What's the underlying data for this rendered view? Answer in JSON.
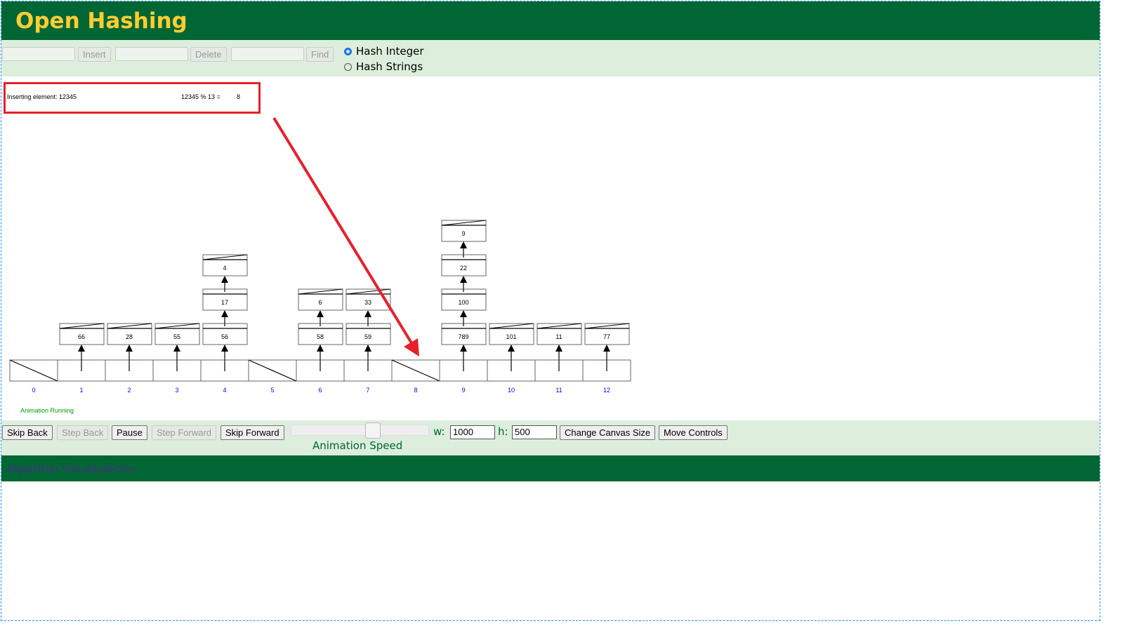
{
  "header": {
    "title": "Open Hashing"
  },
  "controls": {
    "insert_label": "Insert",
    "delete_label": "Delete",
    "find_label": "Find",
    "insert_value": "",
    "delete_value": "",
    "find_value": "",
    "radio_integer": "Hash Integer",
    "radio_strings": "Hash Strings",
    "selected": "Hash Integer"
  },
  "message": {
    "text": "Inserting element: 12345",
    "formula": "12345 % 13 =",
    "result": "8"
  },
  "hash_table": {
    "buckets": [
      "0",
      "1",
      "2",
      "3",
      "4",
      "5",
      "6",
      "7",
      "8",
      "9",
      "10",
      "11",
      "12"
    ],
    "chains": {
      "1": [
        "66"
      ],
      "2": [
        "28"
      ],
      "3": [
        "55"
      ],
      "4": [
        "56",
        "17",
        "4"
      ],
      "6": [
        "58",
        "6"
      ],
      "7": [
        "59",
        "33"
      ],
      "9": [
        "789",
        "100",
        "22",
        "9"
      ],
      "10": [
        "101"
      ],
      "11": [
        "11"
      ],
      "12": [
        "77"
      ]
    }
  },
  "status": "Animation Running",
  "animation": {
    "skip_back": "Skip Back",
    "step_back": "Step Back",
    "pause": "Pause",
    "step_forward": "Step Forward",
    "skip_forward": "Skip Forward",
    "speed_label": "Animation Speed",
    "speed_fraction": 0.6,
    "w_label": "w:",
    "w_value": "1000",
    "h_label": "h:",
    "h_value": "500",
    "change_canvas": "Change Canvas Size",
    "move_controls": "Move Controls"
  },
  "footer": {
    "link": "Algorithm Visualizations"
  },
  "colors": {
    "header": "#006633",
    "title": "#ffcc33",
    "panel": "#ddeedd",
    "annotation": "#e8202a",
    "index": "#0000ff"
  }
}
